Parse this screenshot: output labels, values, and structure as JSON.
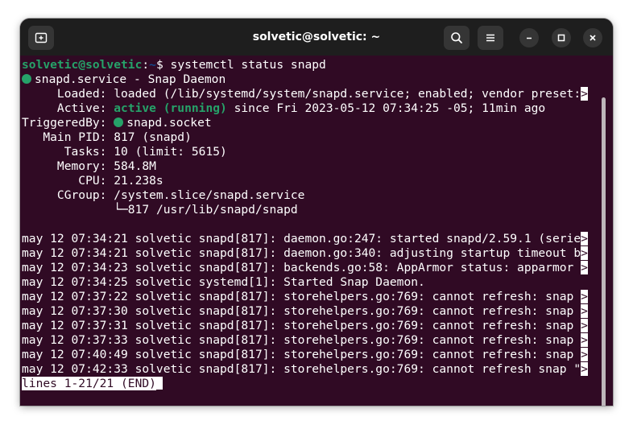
{
  "window": {
    "title": "solvetic@solvetic: ~",
    "background_color": "#300a24",
    "accent_green": "#26a269"
  },
  "titlebar": {
    "new_tab_icon": "new-tab-icon",
    "search_icon": "search-icon",
    "menu_icon": "hamburger-menu-icon",
    "minimize_icon": "minimize-icon",
    "maximize_icon": "maximize-icon",
    "close_icon": "close-icon"
  },
  "terminal": {
    "prompt": {
      "user_host": "solvetic@solvetic",
      "colon": ":",
      "path": "~",
      "symbol": "$ ",
      "command": "systemctl status snapd"
    },
    "service_line": "snapd.service - Snap Daemon",
    "loaded_line": "     Loaded: loaded (/lib/systemd/system/snapd.service; enabled; vendor preset:",
    "active_label": "     Active: ",
    "active_state": "active (running)",
    "active_rest": " since Fri 2023-05-12 07:34:25 -05; 11min ago",
    "triggered_label": "TriggeredBy: ",
    "triggered_value": "snapd.socket",
    "main_pid": "   Main PID: 817 (snapd)",
    "tasks": "      Tasks: 10 (limit: 5615)",
    "memory": "     Memory: 584.8M",
    "cpu": "        CPU: 21.238s",
    "cgroup": "     CGroup: /system.slice/snapd.service",
    "cgroup_child_prefix": "             └─",
    "cgroup_child": "817 /usr/lib/snapd/snapd",
    "truncation_marker": ">",
    "log_lines": [
      "may 12 07:34:21 solvetic snapd[817]: daemon.go:247: started snapd/2.59.1 (serie",
      "may 12 07:34:21 solvetic snapd[817]: daemon.go:340: adjusting startup timeout b",
      "may 12 07:34:23 solvetic snapd[817]: backends.go:58: AppArmor status: apparmor ",
      "may 12 07:34:25 solvetic systemd[1]: Started Snap Daemon.",
      "may 12 07:37:22 solvetic snapd[817]: storehelpers.go:769: cannot refresh: snap ",
      "may 12 07:37:30 solvetic snapd[817]: storehelpers.go:769: cannot refresh: snap ",
      "may 12 07:37:31 solvetic snapd[817]: storehelpers.go:769: cannot refresh: snap ",
      "may 12 07:37:33 solvetic snapd[817]: storehelpers.go:769: cannot refresh: snap ",
      "may 12 07:40:49 solvetic snapd[817]: storehelpers.go:769: cannot refresh: snap ",
      "may 12 07:42:33 solvetic snapd[817]: storehelpers.go:769: cannot refresh snap \""
    ],
    "pager_status": "lines 1-21/21 (END)"
  }
}
